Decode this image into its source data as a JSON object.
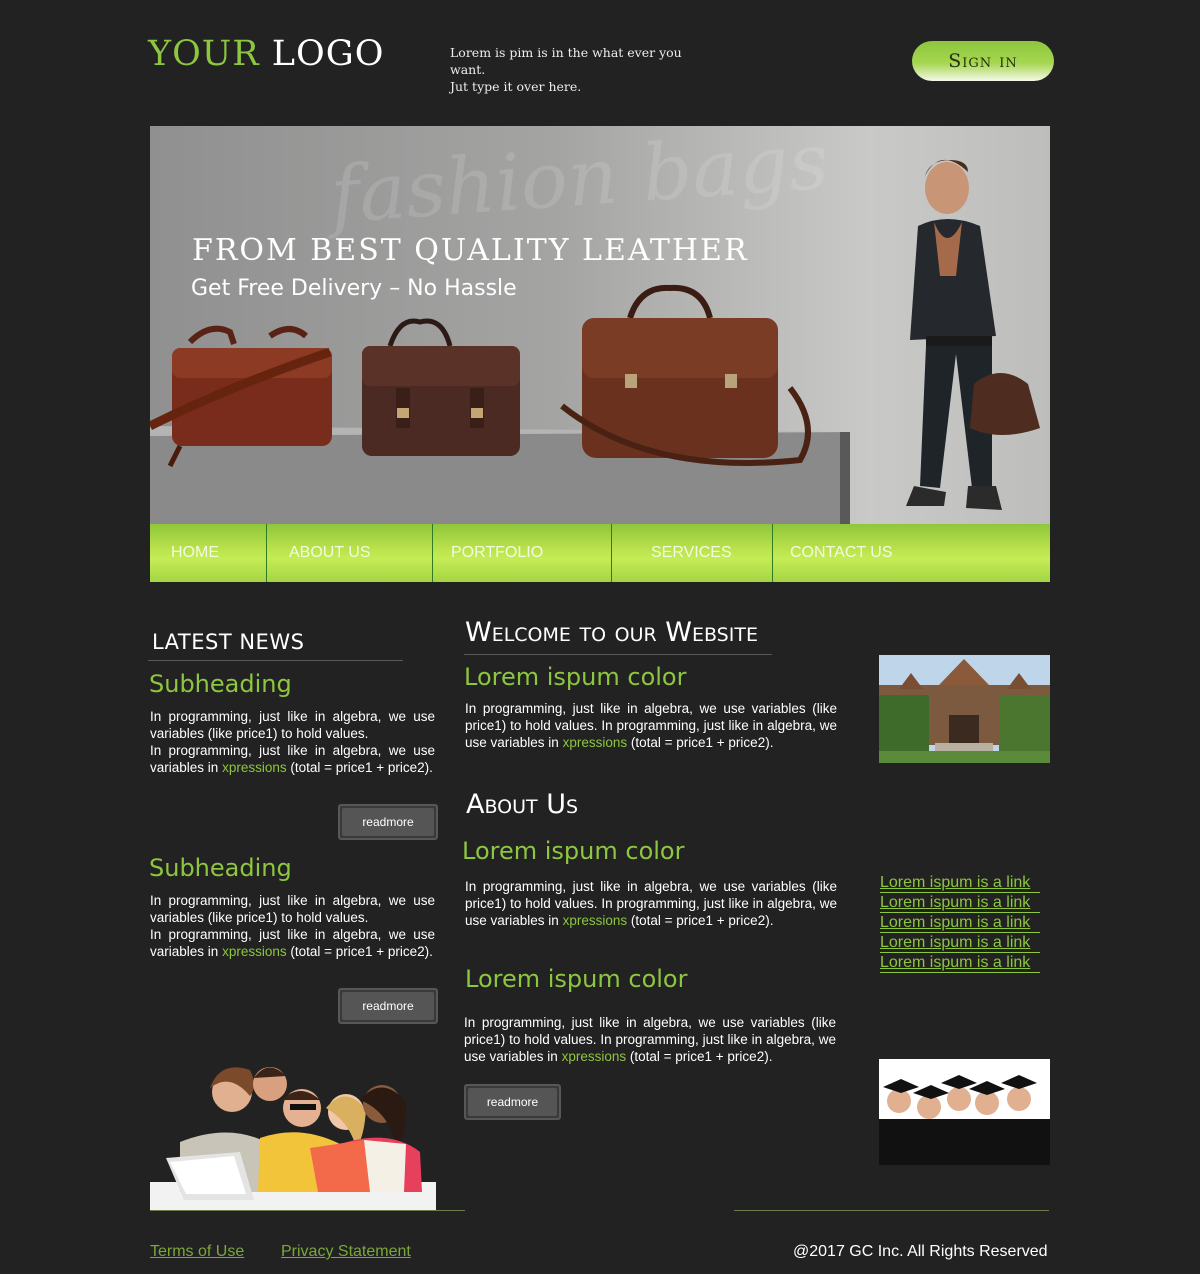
{
  "header": {
    "logo_part1": "YOUR",
    "logo_part2": "LOGO",
    "tagline_line1": "Lorem is pim is in the what ever you want.",
    "tagline_line2": "Jut type it over here.",
    "signin_label": "Sign in"
  },
  "banner": {
    "script_text": "fashion bags",
    "headline": "From Best Quality Leather",
    "subline": "Get Free Delivery – No Hassle"
  },
  "nav": {
    "items": [
      {
        "label": "HOME"
      },
      {
        "label": "ABOUT US"
      },
      {
        "label": "PORTFOLIO"
      },
      {
        "label": "SERVICES"
      },
      {
        "label": "CONTACT US"
      }
    ]
  },
  "news": {
    "title": "Latest News",
    "items": [
      {
        "subheading": "Subheading",
        "text_a": "In programming, just like in algebra, we use variables (like price1) to hold values.",
        "text_b": "In programming, just like in algebra, we use variables in",
        "text_link": "xpressions",
        "text_c": "(total = price1 + price2).",
        "readmore": "readmore"
      },
      {
        "subheading": "Subheading",
        "text_a": "In programming, just like in algebra, we use variables (like price1) to hold values.",
        "text_b": "In programming, just like in algebra, we use variables in",
        "text_link": "xpressions",
        "text_c": "(total = price1 + price2).",
        "readmore": "readmore"
      }
    ]
  },
  "welcome": {
    "title": "Welcome to our Website",
    "heading": "Lorem ispum color",
    "text_a": "In programming, just like in algebra, we use variables (like price1) to hold values. In programming, just like in algebra, we use variables in",
    "text_link": "xpressions",
    "text_c": "(total = price1 + price2)."
  },
  "about": {
    "title": "About Us",
    "block1": {
      "heading": "Lorem ispum color",
      "text_a": "In programming, just like in algebra, we use variables (like price1) to hold values. In programming, just like in algebra, we use variables in",
      "text_link": "xpressions",
      "text_c": "(total = price1 + price2)."
    },
    "block2": {
      "heading": "Lorem ispum color",
      "text_a": "In programming, just like in algebra, we use variables (like price1) to hold values. In programming, just like in algebra, we use variables in",
      "text_link": "xpressions",
      "text_c": "(total = price1 + price2).",
      "readmore": "readmore"
    }
  },
  "links": [
    "Lorem ispum is a link",
    "Lorem ispum is a link",
    "Lorem ispum is a link",
    "Lorem ispum is a link",
    "Lorem ispum is a link"
  ],
  "footer": {
    "terms": "Terms of Use",
    "privacy": "Privacy Statement",
    "copyright": "@2017 GC Inc. All Rights Reserved"
  },
  "colors": {
    "background": "#222222",
    "accent": "#8dc63f",
    "nav_green": "#b7e04b"
  }
}
